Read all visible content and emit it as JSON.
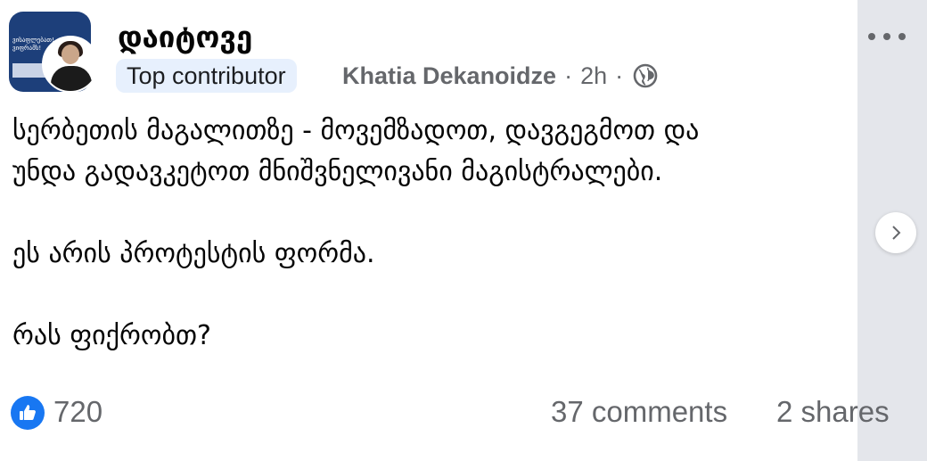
{
  "post": {
    "group_name": "დაიტოვე",
    "badge": "Top contributor",
    "author": "Khatia Dekanoidze",
    "separator": "·",
    "time": "2h",
    "avatar_text": "ვისაფლებათ! ვიფრამს!",
    "body_lines": [
      "სერბეთის მაგალითზე - მოვემზადოთ, დავგეგმოთ და",
      "უნდა გადავკეტოთ მნიშვნელივანი მაგისტრალები.",
      "ეს არის პროტესტის ფორმა.",
      "რას ფიქრობთ?"
    ]
  },
  "reactions": {
    "like_count": "720",
    "comments": "37 comments",
    "shares": "2 shares"
  },
  "icons": {
    "more": "more-horizontal-icon",
    "globe": "globe-icon",
    "like": "thumbs-up-icon",
    "next": "chevron-right-icon"
  },
  "colors": {
    "accent": "#1877f2",
    "badge_bg": "#e7f0fd",
    "meta_text": "#65676b",
    "side_strip": "#e4e6eb"
  }
}
